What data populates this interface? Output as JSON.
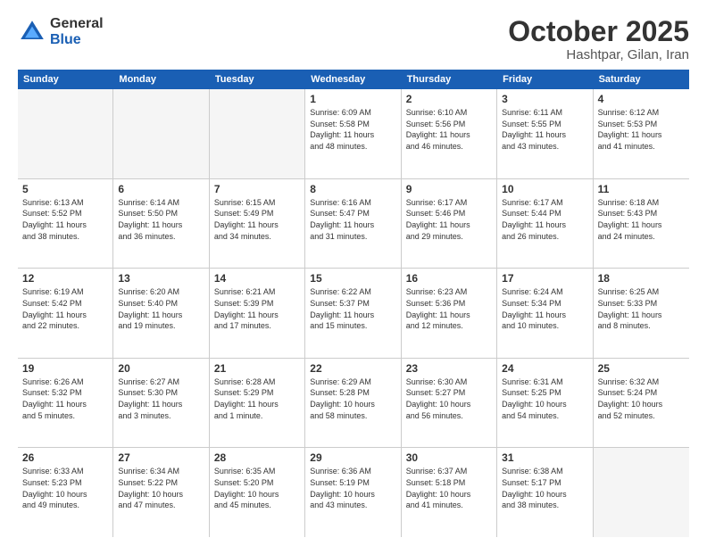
{
  "logo": {
    "general": "General",
    "blue": "Blue"
  },
  "header": {
    "month": "October 2025",
    "location": "Hashtpar, Gilan, Iran"
  },
  "weekdays": [
    "Sunday",
    "Monday",
    "Tuesday",
    "Wednesday",
    "Thursday",
    "Friday",
    "Saturday"
  ],
  "rows": [
    [
      {
        "day": "",
        "info": "",
        "empty": true
      },
      {
        "day": "",
        "info": "",
        "empty": true
      },
      {
        "day": "",
        "info": "",
        "empty": true
      },
      {
        "day": "1",
        "info": "Sunrise: 6:09 AM\nSunset: 5:58 PM\nDaylight: 11 hours\nand 48 minutes."
      },
      {
        "day": "2",
        "info": "Sunrise: 6:10 AM\nSunset: 5:56 PM\nDaylight: 11 hours\nand 46 minutes."
      },
      {
        "day": "3",
        "info": "Sunrise: 6:11 AM\nSunset: 5:55 PM\nDaylight: 11 hours\nand 43 minutes."
      },
      {
        "day": "4",
        "info": "Sunrise: 6:12 AM\nSunset: 5:53 PM\nDaylight: 11 hours\nand 41 minutes."
      }
    ],
    [
      {
        "day": "5",
        "info": "Sunrise: 6:13 AM\nSunset: 5:52 PM\nDaylight: 11 hours\nand 38 minutes."
      },
      {
        "day": "6",
        "info": "Sunrise: 6:14 AM\nSunset: 5:50 PM\nDaylight: 11 hours\nand 36 minutes."
      },
      {
        "day": "7",
        "info": "Sunrise: 6:15 AM\nSunset: 5:49 PM\nDaylight: 11 hours\nand 34 minutes."
      },
      {
        "day": "8",
        "info": "Sunrise: 6:16 AM\nSunset: 5:47 PM\nDaylight: 11 hours\nand 31 minutes."
      },
      {
        "day": "9",
        "info": "Sunrise: 6:17 AM\nSunset: 5:46 PM\nDaylight: 11 hours\nand 29 minutes."
      },
      {
        "day": "10",
        "info": "Sunrise: 6:17 AM\nSunset: 5:44 PM\nDaylight: 11 hours\nand 26 minutes."
      },
      {
        "day": "11",
        "info": "Sunrise: 6:18 AM\nSunset: 5:43 PM\nDaylight: 11 hours\nand 24 minutes."
      }
    ],
    [
      {
        "day": "12",
        "info": "Sunrise: 6:19 AM\nSunset: 5:42 PM\nDaylight: 11 hours\nand 22 minutes."
      },
      {
        "day": "13",
        "info": "Sunrise: 6:20 AM\nSunset: 5:40 PM\nDaylight: 11 hours\nand 19 minutes."
      },
      {
        "day": "14",
        "info": "Sunrise: 6:21 AM\nSunset: 5:39 PM\nDaylight: 11 hours\nand 17 minutes."
      },
      {
        "day": "15",
        "info": "Sunrise: 6:22 AM\nSunset: 5:37 PM\nDaylight: 11 hours\nand 15 minutes."
      },
      {
        "day": "16",
        "info": "Sunrise: 6:23 AM\nSunset: 5:36 PM\nDaylight: 11 hours\nand 12 minutes."
      },
      {
        "day": "17",
        "info": "Sunrise: 6:24 AM\nSunset: 5:34 PM\nDaylight: 11 hours\nand 10 minutes."
      },
      {
        "day": "18",
        "info": "Sunrise: 6:25 AM\nSunset: 5:33 PM\nDaylight: 11 hours\nand 8 minutes."
      }
    ],
    [
      {
        "day": "19",
        "info": "Sunrise: 6:26 AM\nSunset: 5:32 PM\nDaylight: 11 hours\nand 5 minutes."
      },
      {
        "day": "20",
        "info": "Sunrise: 6:27 AM\nSunset: 5:30 PM\nDaylight: 11 hours\nand 3 minutes."
      },
      {
        "day": "21",
        "info": "Sunrise: 6:28 AM\nSunset: 5:29 PM\nDaylight: 11 hours\nand 1 minute."
      },
      {
        "day": "22",
        "info": "Sunrise: 6:29 AM\nSunset: 5:28 PM\nDaylight: 10 hours\nand 58 minutes."
      },
      {
        "day": "23",
        "info": "Sunrise: 6:30 AM\nSunset: 5:27 PM\nDaylight: 10 hours\nand 56 minutes."
      },
      {
        "day": "24",
        "info": "Sunrise: 6:31 AM\nSunset: 5:25 PM\nDaylight: 10 hours\nand 54 minutes."
      },
      {
        "day": "25",
        "info": "Sunrise: 6:32 AM\nSunset: 5:24 PM\nDaylight: 10 hours\nand 52 minutes."
      }
    ],
    [
      {
        "day": "26",
        "info": "Sunrise: 6:33 AM\nSunset: 5:23 PM\nDaylight: 10 hours\nand 49 minutes."
      },
      {
        "day": "27",
        "info": "Sunrise: 6:34 AM\nSunset: 5:22 PM\nDaylight: 10 hours\nand 47 minutes."
      },
      {
        "day": "28",
        "info": "Sunrise: 6:35 AM\nSunset: 5:20 PM\nDaylight: 10 hours\nand 45 minutes."
      },
      {
        "day": "29",
        "info": "Sunrise: 6:36 AM\nSunset: 5:19 PM\nDaylight: 10 hours\nand 43 minutes."
      },
      {
        "day": "30",
        "info": "Sunrise: 6:37 AM\nSunset: 5:18 PM\nDaylight: 10 hours\nand 41 minutes."
      },
      {
        "day": "31",
        "info": "Sunrise: 6:38 AM\nSunset: 5:17 PM\nDaylight: 10 hours\nand 38 minutes."
      },
      {
        "day": "",
        "info": "",
        "empty": true
      }
    ]
  ]
}
